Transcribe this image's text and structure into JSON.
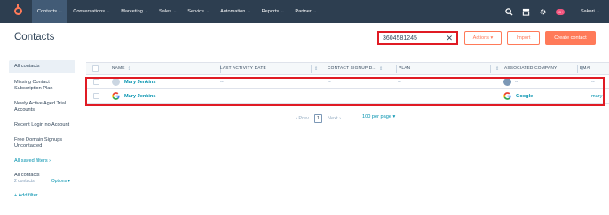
{
  "nav": {
    "items": [
      {
        "label": "Contacts",
        "active": true
      },
      {
        "label": "Conversations",
        "active": false
      },
      {
        "label": "Marketing",
        "active": false
      },
      {
        "label": "Sales",
        "active": false
      },
      {
        "label": "Service",
        "active": false
      },
      {
        "label": "Automation",
        "active": false
      },
      {
        "label": "Reports",
        "active": false
      },
      {
        "label": "Partner",
        "active": false
      }
    ],
    "notification_badge": "99+",
    "account_name": "Sakari",
    "chevron": "⌄"
  },
  "header": {
    "title": "Contacts",
    "search_value": "3604581245",
    "search_clear": "✕",
    "actions_label": "Actions ▾",
    "import_label": "Import",
    "create_label": "Create contact"
  },
  "sidebar": {
    "views": [
      "All contacts",
      "Missing Contact Subscription Plan",
      "Newly Active Aged Trial Accounts",
      "Recent Login no Account",
      "Free Domain Signups Uncontacted"
    ],
    "all_saved_filters": "All saved filters ›",
    "section_title": "All contacts",
    "section_count": "2 contacts",
    "options_label": "Options ▾",
    "add_filter": "+ Add filter"
  },
  "table": {
    "columns": [
      "NAME",
      "LAST ACTIVITY DATE",
      "CONTACT SIGNUP D...",
      "PLAN",
      "ASSOCIATED COMPANY",
      "EMAI"
    ],
    "sort_glyph": "⇕",
    "rows": [
      {
        "name": "Mary Jenkins",
        "avatar": "person-avatar-icon",
        "last_activity": "--",
        "signup": "--",
        "plan": "--",
        "company": "--",
        "email": "--"
      },
      {
        "name": "Mary Jenkins",
        "avatar": "google-logo-icon",
        "last_activity": "--",
        "signup": "--",
        "plan": "--",
        "company": "Google",
        "email": "mary"
      }
    ]
  },
  "pagination": {
    "prev": "‹  Prev",
    "current": "1",
    "next": "Next  ›",
    "per_page": "100 per page ▾"
  },
  "colors": {
    "nav_bg": "#2d3e50",
    "accent": "#ff7a59",
    "link": "#0091ae",
    "highlight": "#e01b24"
  }
}
